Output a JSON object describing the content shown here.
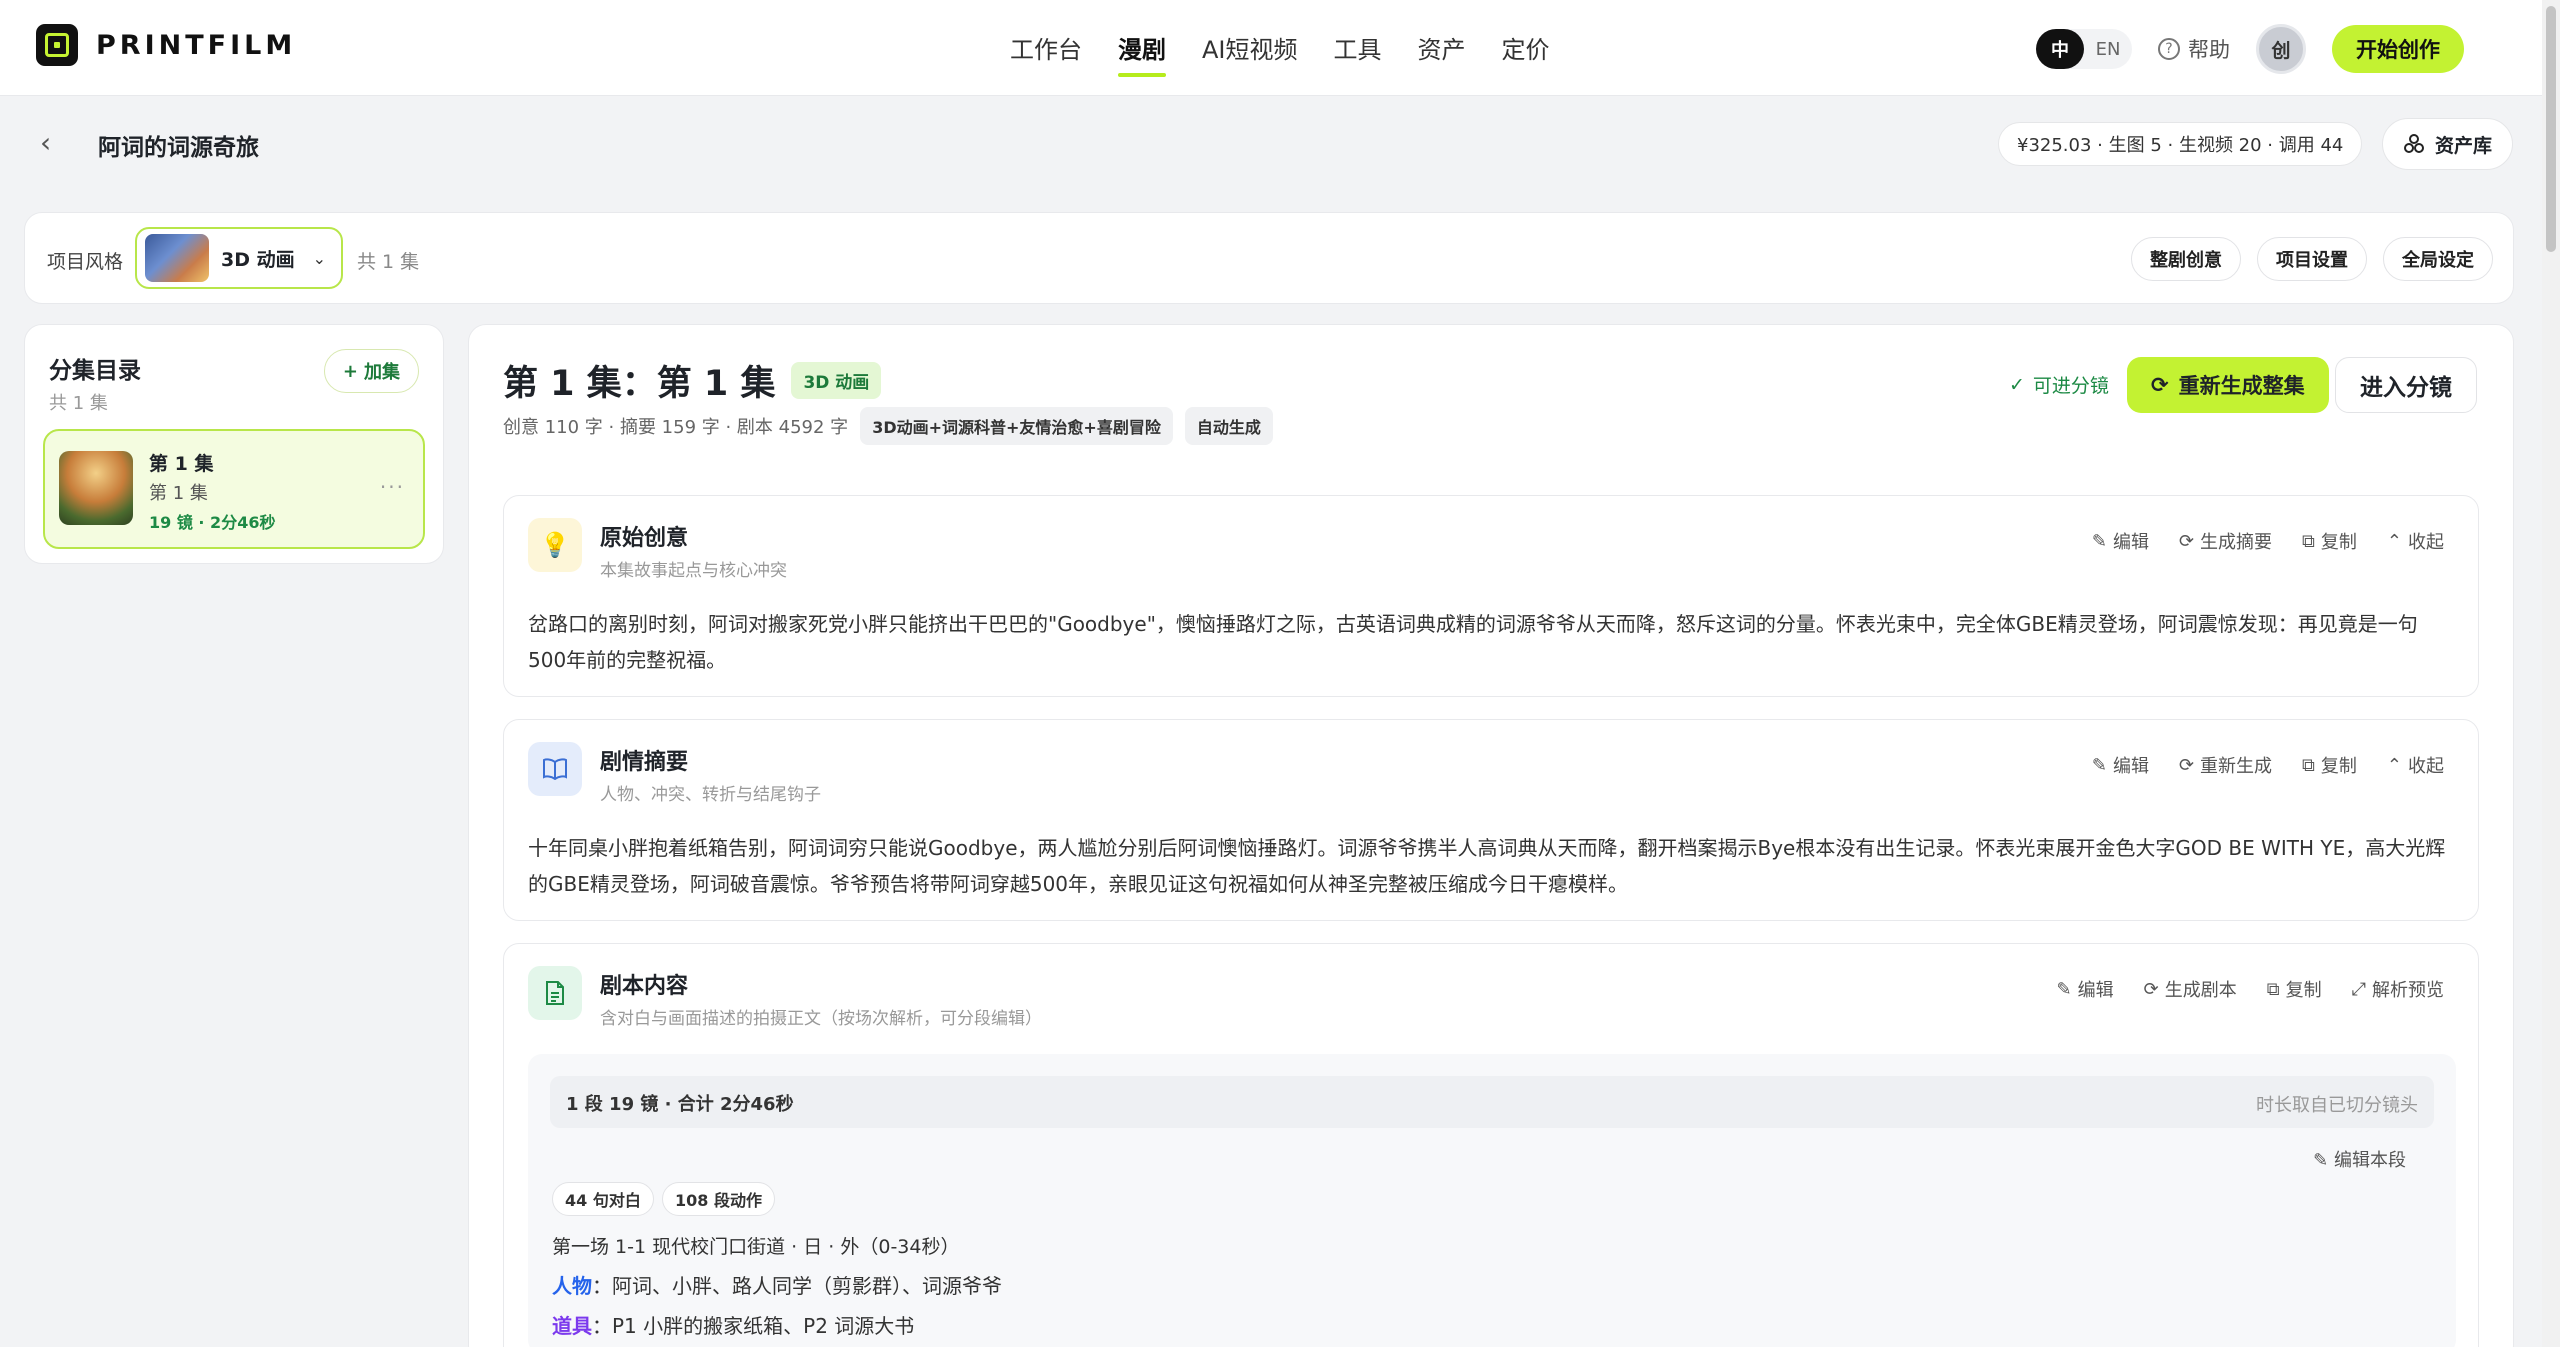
{
  "app": {
    "logo_text": "PRINTFILM"
  },
  "nav": {
    "links": [
      "工作台",
      "漫剧",
      "AI短视频",
      "工具",
      "资产",
      "定价"
    ],
    "active_index": 1,
    "lang_zh": "中",
    "lang_en": "EN",
    "help": "帮助",
    "avatar": "创",
    "start": "开始创作"
  },
  "project": {
    "title": "阿词的词源奇旅",
    "cost": "¥325.03 · 生图 5 · 生视频 20 · 调用 44",
    "asset_lib": "资产库",
    "style_label": "项目风格",
    "style_name": "3D 动画",
    "episode_count": "共 1 集",
    "buttons": [
      "整剧创意",
      "项目设置",
      "全局设定"
    ]
  },
  "sidebar": {
    "title": "分集目录",
    "subtitle": "共 1 集",
    "add_label": "加集",
    "episode": {
      "name": "第 1 集",
      "sub": "第 1 集",
      "meta": "19 镜 · 2分46秒"
    }
  },
  "episode": {
    "title": "第 1 集：第 1 集",
    "style_tag": "3D 动画",
    "stats": "创意 110 字 · 摘要 159 字 · 剧本 4592 字",
    "chip1": "3D动画+词源科普+友情治愈+喜剧冒险",
    "chip2": "自动生成",
    "ready": "可进分镜",
    "regen": "重新生成整集",
    "enter": "进入分镜"
  },
  "sections": {
    "idea": {
      "title": "原始创意",
      "subtitle": "本集故事起点与核心冲突",
      "actions": [
        "编辑",
        "生成摘要",
        "复制",
        "收起"
      ],
      "text": "岔路口的离别时刻，阿词对搬家死党小胖只能挤出干巴巴的\"Goodbye\"，懊恼捶路灯之际，古英语词典成精的词源爷爷从天而降，怒斥这词的分量。怀表光束中，完全体GBE精灵登场，阿词震惊发现：再见竟是一句500年前的完整祝福。"
    },
    "summary": {
      "title": "剧情摘要",
      "subtitle": "人物、冲突、转折与结尾钩子",
      "actions": [
        "编辑",
        "重新生成",
        "复制",
        "收起"
      ],
      "text": "十年同桌小胖抱着纸箱告别，阿词词穷只能说Goodbye，两人尴尬分别后阿词懊恼捶路灯。词源爷爷携半人高词典从天而降，翻开档案揭示Bye根本没有出生记录。怀表光束展开金色大字GOD BE WITH YE，高大光辉的GBE精灵登场，阿词破音震惊。爷爷预告将带阿词穿越500年，亲眼见证这句祝福如何从神圣完整被压缩成今日干瘪模样。"
    },
    "script": {
      "title": "剧本内容",
      "subtitle": "含对白与画面描述的拍摄正文（按场次解析，可分段编辑）",
      "actions": [
        "编辑",
        "生成剧本",
        "复制",
        "解析预览"
      ],
      "seg_left": "1 段   19 镜 · 合计 2分46秒",
      "seg_right": "时长取自已切分镜头",
      "edit_seg": "编辑本段",
      "chip_dialog": "44 句对白",
      "chip_action": "108 段动作",
      "scene": "第一场 1-1 现代校门口街道 · 日 · 外（0-34秒）",
      "roles_label": "人物",
      "roles": "阿词、小胖、路人同学（剪影群）、词源爷爷",
      "props_label": "道具",
      "props": "P1 小胖的搬家纸箱、P2 词源大书"
    }
  }
}
